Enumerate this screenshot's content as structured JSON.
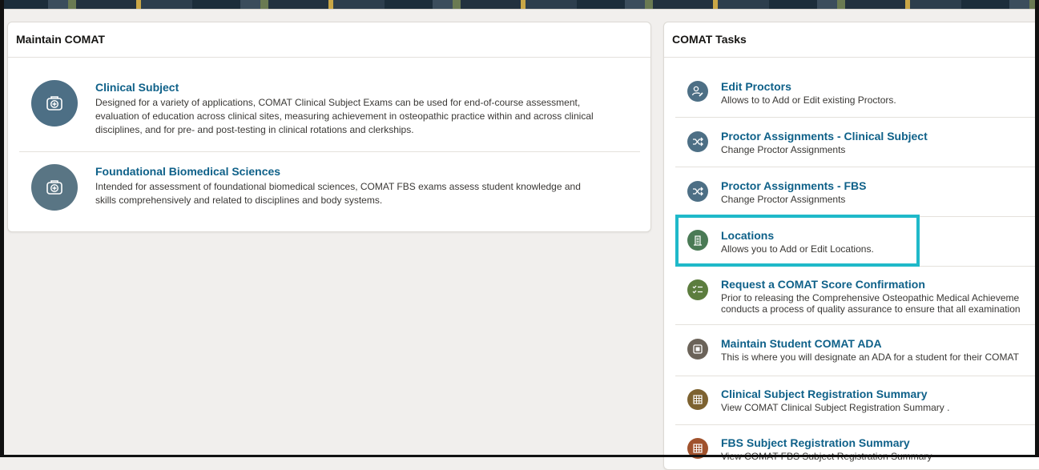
{
  "maintain": {
    "title": "Maintain COMAT",
    "items": [
      {
        "title": "Clinical Subject",
        "desc_lines": [
          "Designed for a variety of applications, COMAT Clinical Subject Exams can be used for end-of-course assessment,",
          "evaluation of education across clinical sites, measuring achievement in osteopathic practice within and across clinical",
          "disciplines, and for pre- and post-testing in clinical rotations and clerkships."
        ],
        "icon": "medical-case-icon"
      },
      {
        "title": "Foundational Biomedical Sciences",
        "desc_lines": [
          "Intended for assessment of foundational biomedical sciences, COMAT FBS exams assess student knowledge and",
          "skills comprehensively and related to disciplines and body systems."
        ],
        "icon": "medical-case-icon"
      }
    ]
  },
  "tasks": {
    "title": "COMAT Tasks",
    "items": [
      {
        "title": "Edit Proctors",
        "desc_lines": [
          "Allows to to Add or Edit existing Proctors."
        ],
        "icon": "person-edit-icon",
        "color": "#4d6f85"
      },
      {
        "title": "Proctor Assignments - Clinical Subject",
        "desc_lines": [
          "Change Proctor Assignments"
        ],
        "icon": "shuffle-icon",
        "color": "#4d6f85"
      },
      {
        "title": "Proctor Assignments - FBS",
        "desc_lines": [
          "Change Proctor Assignments"
        ],
        "icon": "shuffle-icon",
        "color": "#4d6f85"
      },
      {
        "title": "Locations",
        "desc_lines": [
          "Allows you to Add or Edit Locations."
        ],
        "icon": "building-icon",
        "color": "#4a7a55"
      },
      {
        "title": "Request a COMAT Score Confirmation",
        "desc_lines": [
          "Prior to releasing the Comprehensive Osteopathic Medical Achieveme",
          "conducts a process of quality assurance to ensure that all examination"
        ],
        "icon": "checklist-icon",
        "color": "#5c7d3e"
      },
      {
        "title": "Maintain Student COMAT ADA",
        "desc_lines": [
          "This is where you will designate an ADA for a student for their COMAT"
        ],
        "icon": "square-icon",
        "color": "#6b6359"
      },
      {
        "title": "Clinical Subject Registration Summary",
        "desc_lines": [
          "View COMAT Clinical Subject Registration Summary ."
        ],
        "icon": "grid-icon",
        "color": "#7d6230"
      },
      {
        "title": "FBS Subject Registration Summary",
        "desc_lines": [
          "View COMAT FBS Subject Registration Summary"
        ],
        "icon": "grid-icon",
        "color": "#a0522d"
      }
    ]
  },
  "colors": {
    "link": "#0f6189",
    "highlight": "#1fb9c9"
  }
}
